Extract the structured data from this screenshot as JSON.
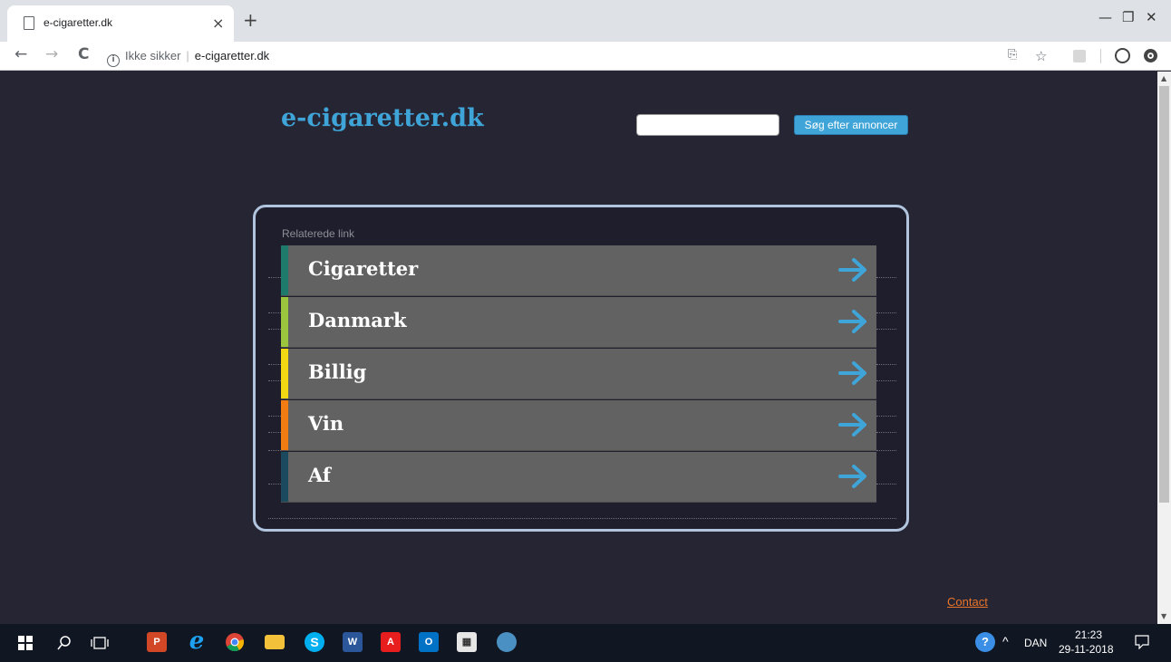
{
  "browser": {
    "tab_title": "e-cigaretter.dk",
    "tab_close": "×",
    "new_tab": "+",
    "window_controls": [
      "—",
      "❐",
      "✕"
    ],
    "nav": {
      "back": "←",
      "forward": "→",
      "reload": "C"
    },
    "address": {
      "security_label": "Ikke sikker",
      "url": "e-cigaretter.dk"
    },
    "toolbar_icons": [
      "translate-icon",
      "star-icon",
      "pdf-icon",
      "account-icon",
      "extension-icon"
    ]
  },
  "page": {
    "site_title": "e-cigaretter.dk",
    "search": {
      "value": "",
      "button_label": "Søg efter annoncer"
    },
    "related": {
      "heading": "Relaterede link",
      "items": [
        {
          "label": "Cigaretter",
          "color": "#1e7a6a"
        },
        {
          "label": "Danmark",
          "color": "#9bc53d"
        },
        {
          "label": "Billig",
          "color": "#f2d813"
        },
        {
          "label": "Vin",
          "color": "#f07c12"
        },
        {
          "label": "Af",
          "color": "#1b4a5e"
        }
      ]
    },
    "contact_label": "Contact",
    "colors": {
      "accent": "#3fa4d8",
      "background": "#262533",
      "contact": "#e8742b"
    }
  },
  "taskbar": {
    "apps": [
      "windows-start-icon",
      "search-icon",
      "task-view-icon",
      "powerpoint-icon",
      "internet-explorer-icon",
      "chrome-icon",
      "file-explorer-icon",
      "skype-icon",
      "word-icon",
      "acrobat-icon",
      "outlook-icon",
      "calculator-icon",
      "globe-icon"
    ],
    "language": "DAN",
    "time": "21:23",
    "date": "29-11-2018"
  }
}
